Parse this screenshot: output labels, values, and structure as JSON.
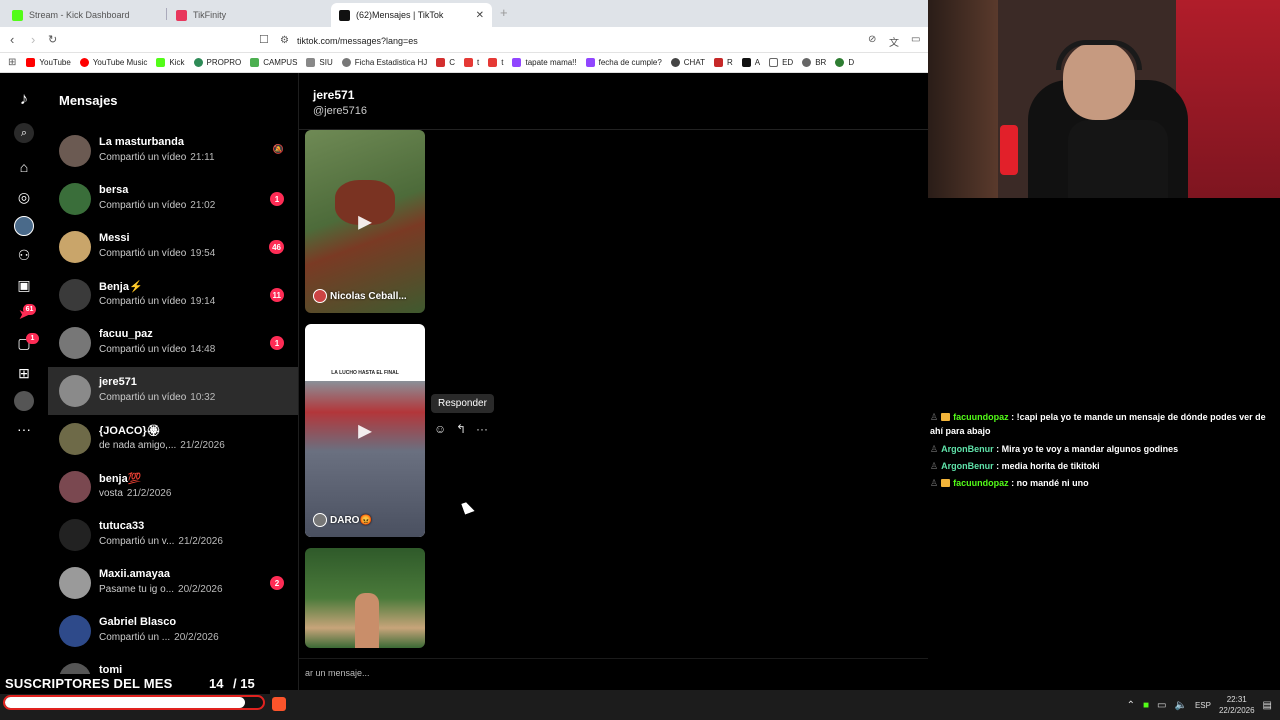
{
  "browser": {
    "tabs": [
      {
        "label": "Stream - Kick Dashboard",
        "color": "#53fc18"
      },
      {
        "label": "TikFinity",
        "color": "#e8375d"
      },
      {
        "label": "(62)Mensajes | TikTok",
        "color": "#111111"
      }
    ],
    "url": "tiktok.com/messages?lang=es",
    "bookmarks": [
      {
        "label": "YouTube",
        "color": "#ff0000"
      },
      {
        "label": "YouTube Music",
        "color": "#ff0000"
      },
      {
        "label": "Kick",
        "color": "#53fc18"
      },
      {
        "label": "PROPRO",
        "color": "#2e8b57"
      },
      {
        "label": "CAMPUS",
        "color": "#4caf50"
      },
      {
        "label": "SIU",
        "color": "#888888"
      },
      {
        "label": "Ficha Estadistica HJ",
        "color": "#777777"
      },
      {
        "label": "C",
        "color": "#d32f2f"
      },
      {
        "label": "t",
        "color": "#e53935"
      },
      {
        "label": "t",
        "color": "#e53935"
      },
      {
        "label": "tapate mama!!",
        "color": "#9146ff"
      },
      {
        "label": "fecha de cumple?",
        "color": "#9146ff"
      },
      {
        "label": "CHAT",
        "color": "#444444"
      },
      {
        "label": "R",
        "color": "#c62828"
      },
      {
        "label": "A",
        "color": "#111111"
      },
      {
        "label": "ED",
        "color": "#666666"
      },
      {
        "label": "BR",
        "color": "#666666"
      },
      {
        "label": "D",
        "color": "#2e7d32"
      }
    ]
  },
  "sidebar": {
    "title": "Mensajes",
    "conversations": [
      {
        "name": "La masturbanda",
        "preview": "Compartió un vídeo",
        "time": "21:11",
        "badge": "",
        "muted": true,
        "avatar": "#6b5a52"
      },
      {
        "name": "bersa",
        "preview": "Compartió un vídeo",
        "time": "21:02",
        "badge": "1",
        "muted": false,
        "avatar": "#3a6e3a"
      },
      {
        "name": "Messi",
        "preview": "Compartió un vídeo",
        "time": "19:54",
        "badge": "46",
        "muted": false,
        "avatar": "#c9a56a"
      },
      {
        "name": "Benja⚡",
        "preview": "Compartió un vídeo",
        "time": "19:14",
        "badge": "11",
        "muted": false,
        "avatar": "#3a3a3a"
      },
      {
        "name": "facuu_paz",
        "preview": "Compartió un vídeo",
        "time": "14:48",
        "badge": "1",
        "muted": false,
        "avatar": "#777777"
      },
      {
        "name": "jere571",
        "preview": "Compartió un vídeo",
        "time": "10:32",
        "badge": "",
        "muted": false,
        "avatar": "#8a8a8a",
        "selected": true
      },
      {
        "name": "{JOACO}🏵",
        "preview": "de nada amigo,...",
        "time": "21/2/2026",
        "badge": "",
        "muted": false,
        "avatar": "#6e6a48"
      },
      {
        "name": "benja💯",
        "preview": "vosta",
        "time": "21/2/2026",
        "badge": "",
        "muted": false,
        "avatar": "#7a4850"
      },
      {
        "name": "tutuca33",
        "preview": "Compartió un v...",
        "time": "21/2/2026",
        "badge": "",
        "muted": false,
        "avatar": "#222222"
      },
      {
        "name": "Maxii.amayaa",
        "preview": "Pasame tu ig o...",
        "time": "20/2/2026",
        "badge": "2",
        "muted": false,
        "avatar": "#9a9a9a"
      },
      {
        "name": "Gabriel Blasco",
        "preview": "Compartió un ...",
        "time": "20/2/2026",
        "badge": "",
        "muted": false,
        "avatar": "#2e4a8a"
      },
      {
        "name": "tomi",
        "preview": "",
        "time": "",
        "badge": "",
        "muted": false,
        "avatar": "#555555"
      }
    ]
  },
  "rail": {
    "badges": [
      "61",
      "1"
    ]
  },
  "chat": {
    "name": "jere571",
    "handle": "@jere5716",
    "videos": [
      {
        "author": "Nicolas Ceball...",
        "bg": "#4d6b3a"
      },
      {
        "author": "DARO😡",
        "caption": "LA LUCHO HASTA EL FINAL",
        "bg": "#6b6f78"
      },
      {
        "author": "",
        "bg": "#3f6b3a"
      }
    ],
    "tooltip": "Responder",
    "composer_placeholder": "ar un mensaje..."
  },
  "stream_chat": [
    {
      "user": "facuundopaz",
      "crown": true,
      "text": "!capi pela yo te mande un mensaje de dónde podes ver de ahí para abajo",
      "color": "u1"
    },
    {
      "user": "ArgonBenur",
      "crown": false,
      "text": "Mira yo te voy a mandar algunos godines",
      "color": "u2"
    },
    {
      "user": "ArgonBenur",
      "crown": false,
      "text": "media horita de tikitoki",
      "color": "u2"
    },
    {
      "user": "facuundopaz",
      "crown": true,
      "text": "no mandé ni uno",
      "color": "u1"
    }
  ],
  "subs": {
    "label": "SUSCRIPTORES DEL MES",
    "count": "14",
    "goal": "/ 15",
    "progress": 0.93
  },
  "taskbar": {
    "lang": "ESP",
    "time": "22:31",
    "date": "22/2/2026"
  }
}
